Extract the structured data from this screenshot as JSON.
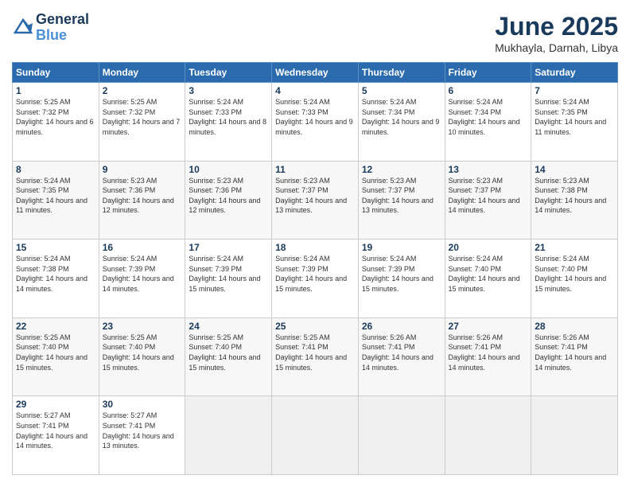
{
  "header": {
    "logo_line1": "General",
    "logo_line2": "Blue",
    "month_title": "June 2025",
    "location": "Mukhayla, Darnah, Libya"
  },
  "weekdays": [
    "Sunday",
    "Monday",
    "Tuesday",
    "Wednesday",
    "Thursday",
    "Friday",
    "Saturday"
  ],
  "weeks": [
    [
      {
        "day": "1",
        "sunrise": "5:25 AM",
        "sunset": "7:32 PM",
        "daylight": "14 hours and 6 minutes."
      },
      {
        "day": "2",
        "sunrise": "5:25 AM",
        "sunset": "7:32 PM",
        "daylight": "14 hours and 7 minutes."
      },
      {
        "day": "3",
        "sunrise": "5:24 AM",
        "sunset": "7:33 PM",
        "daylight": "14 hours and 8 minutes."
      },
      {
        "day": "4",
        "sunrise": "5:24 AM",
        "sunset": "7:33 PM",
        "daylight": "14 hours and 9 minutes."
      },
      {
        "day": "5",
        "sunrise": "5:24 AM",
        "sunset": "7:34 PM",
        "daylight": "14 hours and 9 minutes."
      },
      {
        "day": "6",
        "sunrise": "5:24 AM",
        "sunset": "7:34 PM",
        "daylight": "14 hours and 10 minutes."
      },
      {
        "day": "7",
        "sunrise": "5:24 AM",
        "sunset": "7:35 PM",
        "daylight": "14 hours and 11 minutes."
      }
    ],
    [
      {
        "day": "8",
        "sunrise": "5:24 AM",
        "sunset": "7:35 PM",
        "daylight": "14 hours and 11 minutes."
      },
      {
        "day": "9",
        "sunrise": "5:23 AM",
        "sunset": "7:36 PM",
        "daylight": "14 hours and 12 minutes."
      },
      {
        "day": "10",
        "sunrise": "5:23 AM",
        "sunset": "7:36 PM",
        "daylight": "14 hours and 12 minutes."
      },
      {
        "day": "11",
        "sunrise": "5:23 AM",
        "sunset": "7:37 PM",
        "daylight": "14 hours and 13 minutes."
      },
      {
        "day": "12",
        "sunrise": "5:23 AM",
        "sunset": "7:37 PM",
        "daylight": "14 hours and 13 minutes."
      },
      {
        "day": "13",
        "sunrise": "5:23 AM",
        "sunset": "7:37 PM",
        "daylight": "14 hours and 14 minutes."
      },
      {
        "day": "14",
        "sunrise": "5:23 AM",
        "sunset": "7:38 PM",
        "daylight": "14 hours and 14 minutes."
      }
    ],
    [
      {
        "day": "15",
        "sunrise": "5:24 AM",
        "sunset": "7:38 PM",
        "daylight": "14 hours and 14 minutes."
      },
      {
        "day": "16",
        "sunrise": "5:24 AM",
        "sunset": "7:39 PM",
        "daylight": "14 hours and 14 minutes."
      },
      {
        "day": "17",
        "sunrise": "5:24 AM",
        "sunset": "7:39 PM",
        "daylight": "14 hours and 15 minutes."
      },
      {
        "day": "18",
        "sunrise": "5:24 AM",
        "sunset": "7:39 PM",
        "daylight": "14 hours and 15 minutes."
      },
      {
        "day": "19",
        "sunrise": "5:24 AM",
        "sunset": "7:39 PM",
        "daylight": "14 hours and 15 minutes."
      },
      {
        "day": "20",
        "sunrise": "5:24 AM",
        "sunset": "7:40 PM",
        "daylight": "14 hours and 15 minutes."
      },
      {
        "day": "21",
        "sunrise": "5:24 AM",
        "sunset": "7:40 PM",
        "daylight": "14 hours and 15 minutes."
      }
    ],
    [
      {
        "day": "22",
        "sunrise": "5:25 AM",
        "sunset": "7:40 PM",
        "daylight": "14 hours and 15 minutes."
      },
      {
        "day": "23",
        "sunrise": "5:25 AM",
        "sunset": "7:40 PM",
        "daylight": "14 hours and 15 minutes."
      },
      {
        "day": "24",
        "sunrise": "5:25 AM",
        "sunset": "7:40 PM",
        "daylight": "14 hours and 15 minutes."
      },
      {
        "day": "25",
        "sunrise": "5:25 AM",
        "sunset": "7:41 PM",
        "daylight": "14 hours and 15 minutes."
      },
      {
        "day": "26",
        "sunrise": "5:26 AM",
        "sunset": "7:41 PM",
        "daylight": "14 hours and 14 minutes."
      },
      {
        "day": "27",
        "sunrise": "5:26 AM",
        "sunset": "7:41 PM",
        "daylight": "14 hours and 14 minutes."
      },
      {
        "day": "28",
        "sunrise": "5:26 AM",
        "sunset": "7:41 PM",
        "daylight": "14 hours and 14 minutes."
      }
    ],
    [
      {
        "day": "29",
        "sunrise": "5:27 AM",
        "sunset": "7:41 PM",
        "daylight": "14 hours and 14 minutes."
      },
      {
        "day": "30",
        "sunrise": "5:27 AM",
        "sunset": "7:41 PM",
        "daylight": "14 hours and 13 minutes."
      },
      null,
      null,
      null,
      null,
      null
    ]
  ]
}
